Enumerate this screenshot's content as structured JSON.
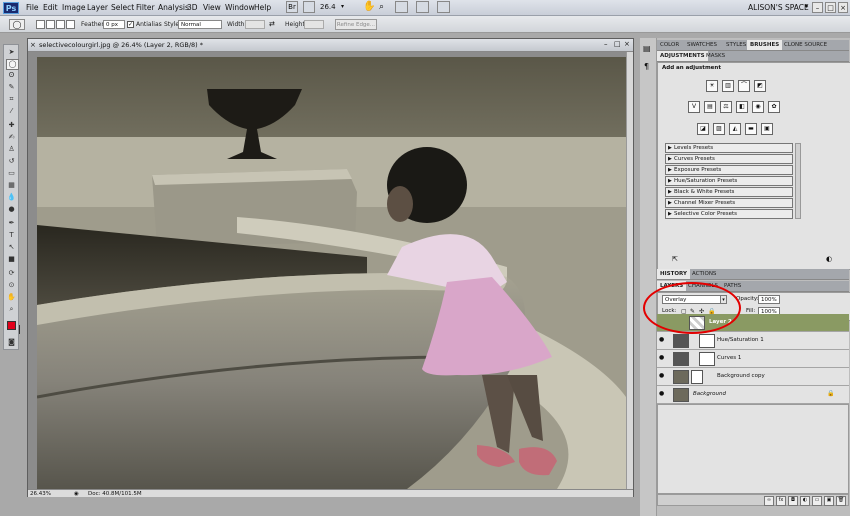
{
  "menubar": {
    "logo": "Ps",
    "menus": [
      "File",
      "Edit",
      "Image",
      "Layer",
      "Select",
      "Filter",
      "Analysis",
      "3D",
      "View",
      "Window",
      "Help"
    ],
    "zoom": "26.4",
    "workspace": "ALISON'S SPACE"
  },
  "options": {
    "feather_label": "Feather:",
    "feather_value": "0 px",
    "antialias_label": "Antialias",
    "style_label": "Style:",
    "style_value": "Normal",
    "width_label": "Width:",
    "height_label": "Height:",
    "refine_label": "Refine Edge..."
  },
  "document": {
    "title": "selectivecolourgirl.jpg @ 26.4% (Layer 2, RGB/8) *",
    "zoom": "26.43%",
    "info": "Doc: 40.8M/101.5M"
  },
  "panels": {
    "top_tabs": [
      "COLOR",
      "SWATCHES",
      "STYLES",
      "BRUSHES",
      "CLONE SOURCE"
    ],
    "adj_tabs": [
      "ADJUSTMENTS",
      "MASKS"
    ],
    "adj_heading": "Add an adjustment",
    "presets": [
      "Levels Presets",
      "Curves Presets",
      "Exposure Presets",
      "Hue/Saturation Presets",
      "Black & White Presets",
      "Channel Mixer Presets",
      "Selective Color Presets"
    ],
    "hist_tabs": [
      "HISTORY",
      "ACTIONS"
    ],
    "layer_tabs": [
      "LAYERS",
      "CHANNELS",
      "PATHS"
    ],
    "blend_mode": "Overlay",
    "opacity_label": "Opacity:",
    "opacity_value": "100%",
    "lock_label": "Lock:",
    "fill_label": "Fill:",
    "fill_value": "100%",
    "layers": [
      {
        "name": "Layer 2",
        "selected": true
      },
      {
        "name": "Hue/Saturation 1",
        "selected": false
      },
      {
        "name": "Curves 1",
        "selected": false
      },
      {
        "name": "Background copy",
        "selected": false
      },
      {
        "name": "Background",
        "selected": false
      }
    ]
  },
  "colors": {
    "foreground": "#e0001a",
    "background": "#ffffff",
    "selected_layer": "#8a9a63",
    "annotation": "#e30000"
  }
}
